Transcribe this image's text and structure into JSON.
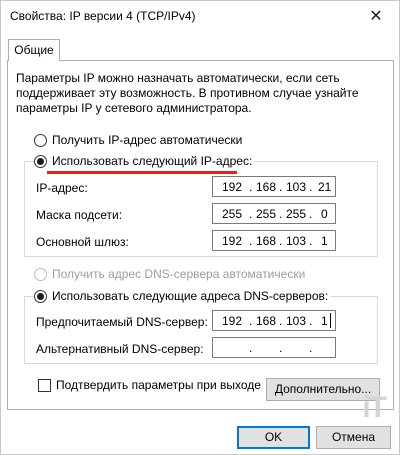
{
  "window": {
    "title": "Свойства: IP версии 4 (TCP/IPv4)",
    "close_icon": "close-icon"
  },
  "tabs": [
    {
      "label": "Общие"
    }
  ],
  "description": "Параметры IP можно назначать автоматически, если сеть поддерживает эту возможность. В противном случае узнайте параметры IP у сетевого администратора.",
  "ip_mode": {
    "auto_label": "Получить IP-адрес автоматически",
    "manual_label": "Использовать следующий IP-адрес:",
    "selected": "manual"
  },
  "ip_fields": {
    "address": {
      "label": "IP-адрес:",
      "octets": [
        "192",
        "168",
        "103",
        "21"
      ]
    },
    "subnet": {
      "label": "Маска подсети:",
      "octets": [
        "255",
        "255",
        "255",
        "0"
      ]
    },
    "gateway": {
      "label": "Основной шлюз:",
      "octets": [
        "192",
        "168",
        "103",
        "1"
      ]
    }
  },
  "dns_mode": {
    "auto_label": "Получить адрес DNS-сервера автоматически",
    "manual_label": "Использовать следующие адреса DNS-серверов:",
    "selected": "manual",
    "auto_disabled": true
  },
  "dns_fields": {
    "preferred": {
      "label": "Предпочитаемый DNS-сервер:",
      "octets": [
        "192",
        "168",
        "103",
        "1"
      ]
    },
    "alternate": {
      "label": "Альтернативный DNS-сервер:",
      "octets": [
        "",
        "",
        "",
        ""
      ]
    }
  },
  "validate_checkbox": {
    "label": "Подтвердить параметры при выходе",
    "checked": false
  },
  "buttons": {
    "advanced": "Дополнительно...",
    "ok": "OK",
    "cancel": "Отмена"
  },
  "watermark": "iT",
  "colors": {
    "accent": "#0078d7",
    "annotation_underline": "#e2231a"
  }
}
